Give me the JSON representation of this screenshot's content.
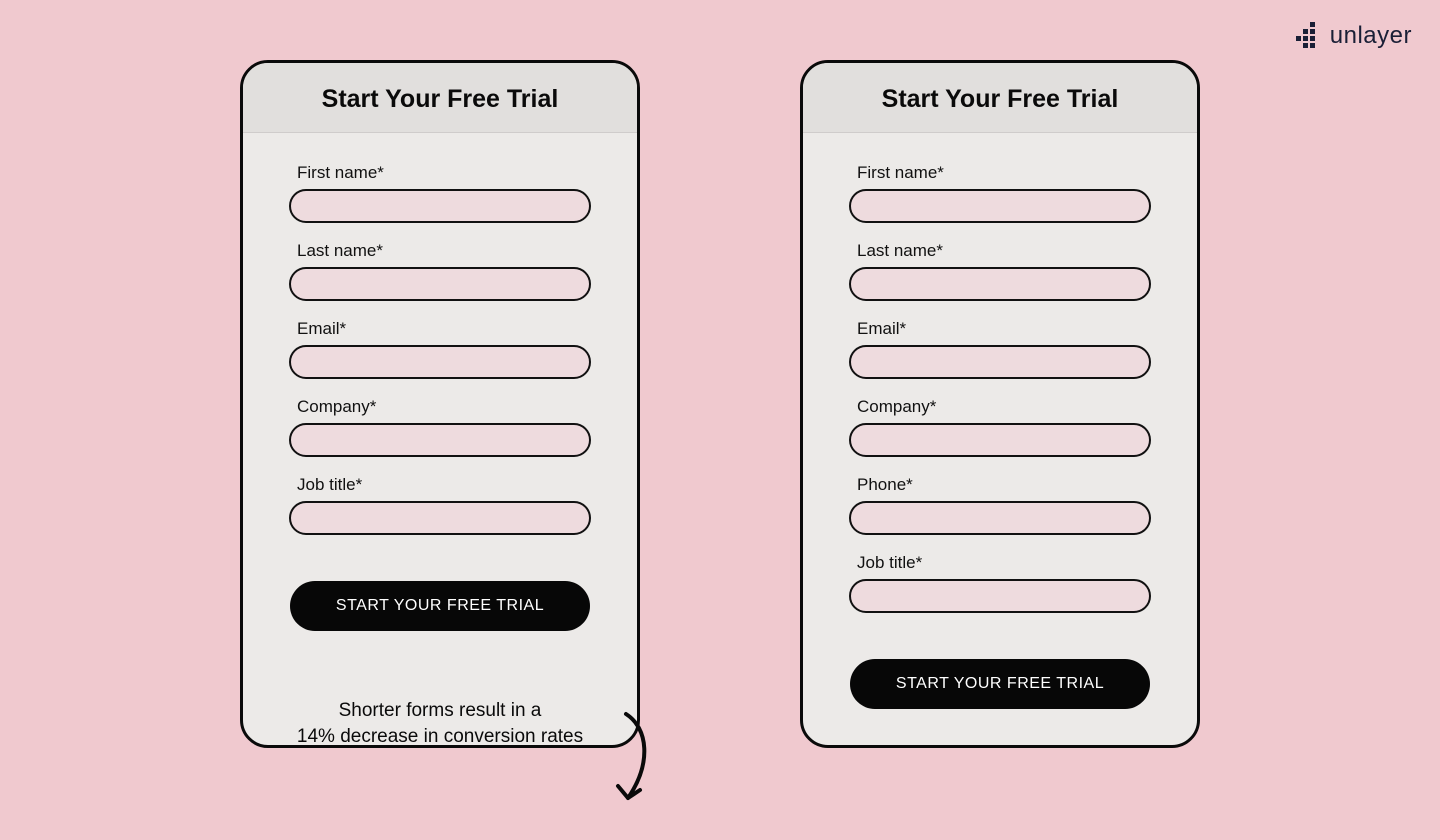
{
  "brand": {
    "name": "unlayer"
  },
  "cards": {
    "left": {
      "title": "Start Your Free Trial",
      "fields": [
        {
          "label": "First name*"
        },
        {
          "label": "Last name*"
        },
        {
          "label": "Email*"
        },
        {
          "label": "Company*"
        },
        {
          "label": "Job title*"
        }
      ],
      "button": "START YOUR FREE TRIAL"
    },
    "right": {
      "title": "Start Your Free Trial",
      "fields": [
        {
          "label": "First name*"
        },
        {
          "label": "Last name*"
        },
        {
          "label": "Email*"
        },
        {
          "label": "Company*"
        },
        {
          "label": "Phone*"
        },
        {
          "label": "Job title*"
        }
      ],
      "button": "START YOUR FREE TRIAL"
    }
  },
  "caption": {
    "line1": "Shorter forms result in a",
    "line2": "14% decrease in conversion rates"
  }
}
